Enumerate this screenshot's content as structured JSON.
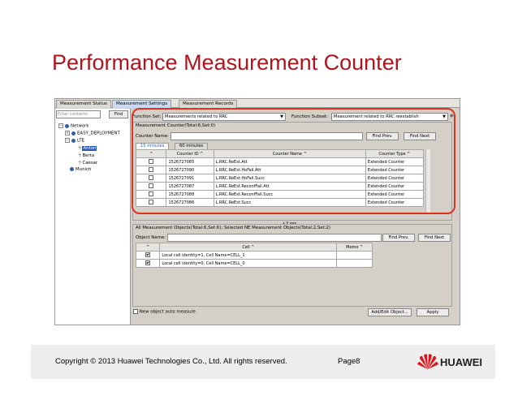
{
  "slide": {
    "title": "Performance Measurement Counter",
    "footer_copyright": "Copyright © 2013 Huawei Technologies Co., Ltd. All rights reserved.",
    "page": "Page8",
    "logo_text": "HUAWEI",
    "highlight_color": "#e0301e",
    "title_color": "#b0141c"
  },
  "app": {
    "tabs": [
      "Measurement Status",
      "Measurement Settings",
      "Measurement Records"
    ],
    "active_tab": "Measurement Settings",
    "search_placeholder": "Enter contents",
    "find_label": "Find",
    "tree": {
      "network": "Network",
      "easy": "EASY_DEPLOYMENT",
      "lte": "LTE",
      "anton": "Anton",
      "berta": "Berta",
      "caesar": "Caesar",
      "munich": "Munich"
    },
    "function_set_label": "Function Set:",
    "function_set_value": "Measurements related to RRC",
    "function_subset_label": "Function Subset:",
    "function_subset_value": "Measurement related to RRC reestablish",
    "counter_group_title": "Measurement Counter(Total:6,Set:0)",
    "counter_name_label": "Counter Name:",
    "find_prev": "Find Prev.",
    "find_next": "Find Next",
    "subtabs": [
      "15 minutes",
      "60 minutes"
    ],
    "counter_columns": [
      "",
      "Counter ID",
      "Counter Name",
      "Counter Type"
    ],
    "counters": [
      {
        "id": "1526727085",
        "name": "L.RRC.ReEst.Att",
        "type": "Extended Counter"
      },
      {
        "id": "1526727090",
        "name": "L.RRC.ReEst.HoFail.Att",
        "type": "Extended Counter"
      },
      {
        "id": "1526727091",
        "name": "L.RRC.ReEst.HoFail.Succ",
        "type": "Extended Counter"
      },
      {
        "id": "1526727087",
        "name": "L.RRC.ReEst.ReconfFail.Att",
        "type": "Extended Counter"
      },
      {
        "id": "1526727088",
        "name": "L.RRC.ReEst.ReconfFail.Succ",
        "type": "Extended Counter"
      },
      {
        "id": "1526727086",
        "name": "L.RRC.ReEst.Succ",
        "type": "Extended Counter"
      }
    ],
    "objects_group_title": "All Measurement Objects(Total:6,Set:6); Selected NE Measurement Objects(Total:2,Set:2)",
    "object_name_label": "Object Name:",
    "object_find_prev": "Find Prev.",
    "object_find_next": "Find Next",
    "object_columns": [
      "",
      "Cell",
      "Memo"
    ],
    "objects": [
      {
        "cell": "Local cell identity=1, Cell Name=CELL_1",
        "memo": ""
      },
      {
        "cell": "Local cell identity=0, Cell Name=CELL_0",
        "memo": ""
      }
    ],
    "auto_measure_label": "New object auto measure",
    "add_edit_label": "Add/Edit Object...",
    "apply_label": "Apply"
  }
}
